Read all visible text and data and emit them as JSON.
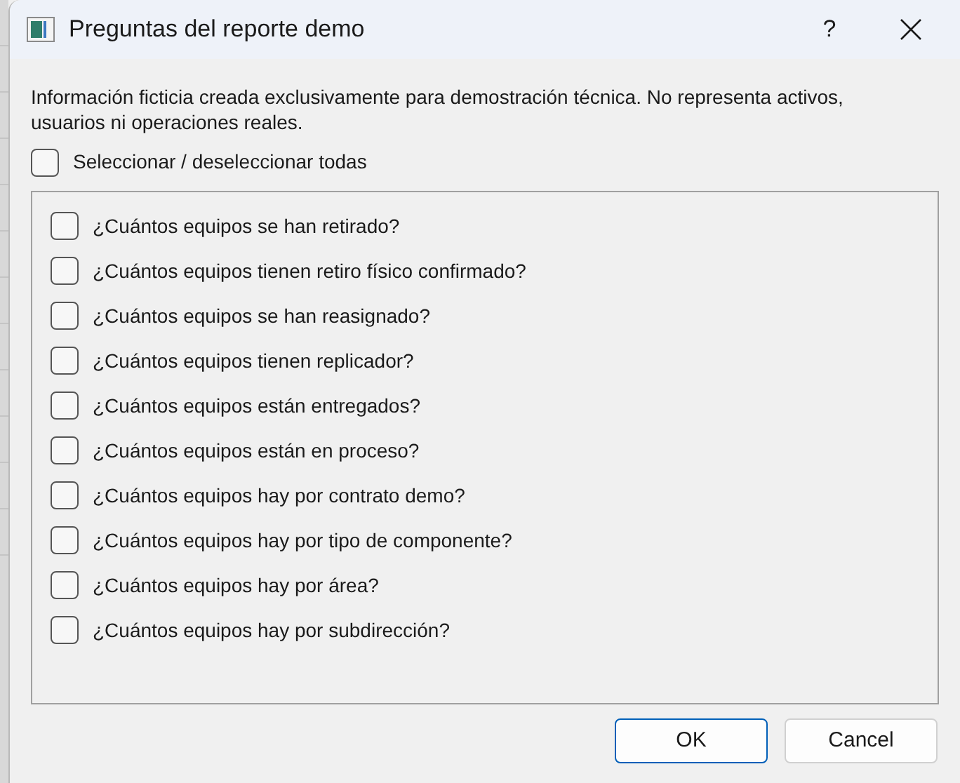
{
  "window": {
    "title": "Preguntas del reporte demo",
    "help": "?"
  },
  "notice": "Información ficticia creada exclusivamente para demostración técnica. No representa activos, usuarios ni operaciones reales.",
  "select_all": {
    "label": "Seleccionar / deseleccionar todas",
    "checked": false
  },
  "questions": [
    {
      "label": "¿Cuántos equipos se han retirado?",
      "checked": false
    },
    {
      "label": "¿Cuántos equipos tienen retiro físico confirmado?",
      "checked": false
    },
    {
      "label": "¿Cuántos equipos se han reasignado?",
      "checked": false
    },
    {
      "label": "¿Cuántos equipos tienen replicador?",
      "checked": false
    },
    {
      "label": "¿Cuántos equipos están entregados?",
      "checked": false
    },
    {
      "label": "¿Cuántos equipos están en proceso?",
      "checked": false
    },
    {
      "label": "¿Cuántos equipos hay por contrato demo?",
      "checked": false
    },
    {
      "label": "¿Cuántos equipos hay por tipo de componente?",
      "checked": false
    },
    {
      "label": "¿Cuántos equipos hay por área?",
      "checked": false
    },
    {
      "label": "¿Cuántos equipos hay por subdirección?",
      "checked": false
    }
  ],
  "buttons": [
    {
      "label": "OK",
      "kind": "default"
    },
    {
      "label": "Cancel",
      "kind": "normal"
    }
  ]
}
